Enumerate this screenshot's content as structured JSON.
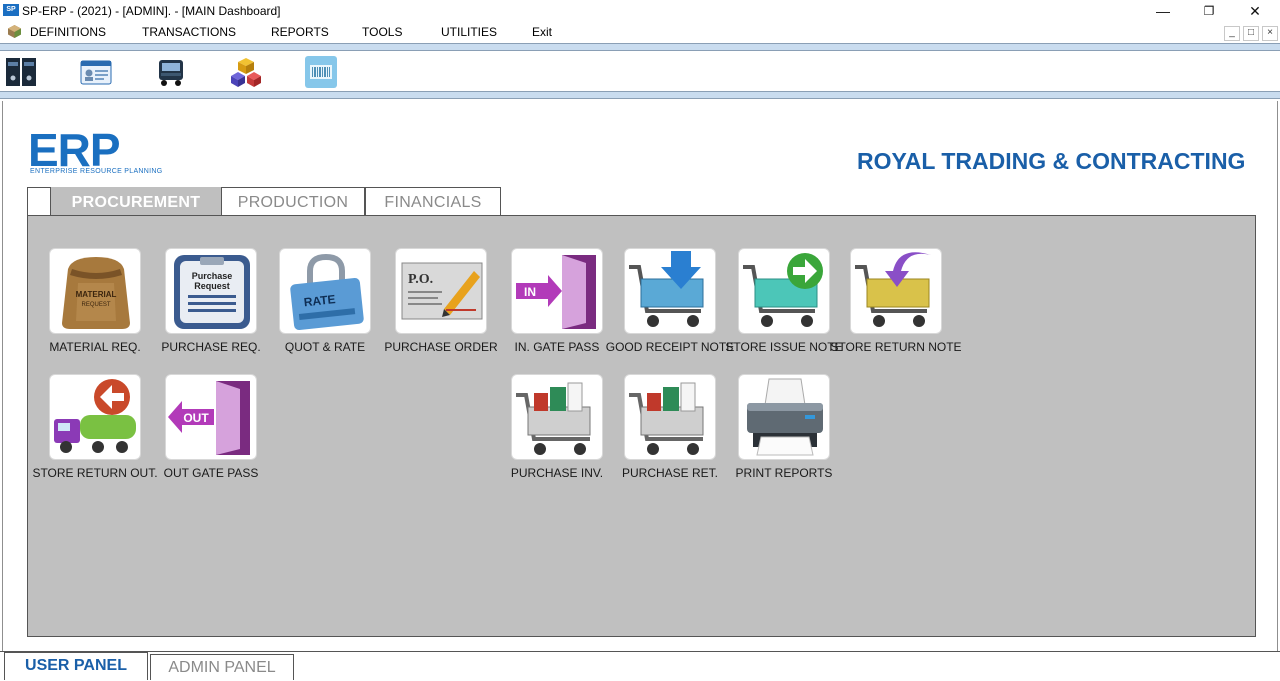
{
  "window": {
    "app_icon_text": "SP",
    "title": "SP-ERP - (2021) - [ADMIN]. - [MAIN Dashboard]"
  },
  "menu": {
    "items": [
      "DEFINITIONS",
      "TRANSACTIONS",
      "REPORTS",
      "TOOLS",
      "UTILITIES",
      "Exit"
    ]
  },
  "toolbar": {
    "icons": [
      "binders-icon",
      "id-card-icon",
      "truck-icon",
      "boxes-icon",
      "barcode-icon"
    ]
  },
  "branding": {
    "logo_text": "ERP",
    "logo_subtitle": "ENTERPRISE RESOURCE PLANNING",
    "company_name": "ROYAL TRADING & CONTRACTING"
  },
  "tabs": {
    "active": "PROCUREMENT",
    "items": [
      "PROCUREMENT",
      "PRODUCTION",
      "FINANCIALS"
    ]
  },
  "tiles": {
    "material_req": {
      "label": "MATERIAL REQ.",
      "icon": "material-bag-icon",
      "art_text": "MATERIAL REQUEST"
    },
    "purchase_req": {
      "label": "PURCHASE REQ.",
      "icon": "purchase-request-icon",
      "art_text": "Purchase Request"
    },
    "quot_rate": {
      "label": "QUOT & RATE",
      "icon": "rate-lock-icon",
      "art_text": "RATE"
    },
    "purchase_order": {
      "label": "PURCHASE ORDER",
      "icon": "po-document-icon",
      "art_text": "P.O."
    },
    "in_gate_pass": {
      "label": "IN. GATE PASS",
      "icon": "door-in-icon",
      "art_text": "IN"
    },
    "good_receipt_note": {
      "label": "GOOD RECEIPT NOTE",
      "icon": "cart-down-icon"
    },
    "store_issue_note": {
      "label": "STORE ISSUE NOTE",
      "icon": "cart-right-icon"
    },
    "store_return_note": {
      "label": "STORE RETURN NOTE",
      "icon": "cart-return-icon"
    },
    "store_return_out": {
      "label": "STORE RETURN OUT.",
      "icon": "truck-return-icon"
    },
    "out_gate_pass": {
      "label": "OUT GATE PASS",
      "icon": "door-out-icon",
      "art_text": "OUT"
    },
    "purchase_inv": {
      "label": "PURCHASE INV.",
      "icon": "shopping-cart-icon"
    },
    "purchase_ret": {
      "label": "PURCHASE RET.",
      "icon": "shopping-cart-return-icon"
    },
    "print_reports": {
      "label": "PRINT REPORTS",
      "icon": "printer-icon"
    }
  },
  "bottom_tabs": {
    "active": "USER PANEL",
    "items": [
      "USER PANEL",
      "ADMIN PANEL"
    ]
  },
  "colors": {
    "accent": "#1a5fa8",
    "panel_bg": "#c0c0c0"
  }
}
